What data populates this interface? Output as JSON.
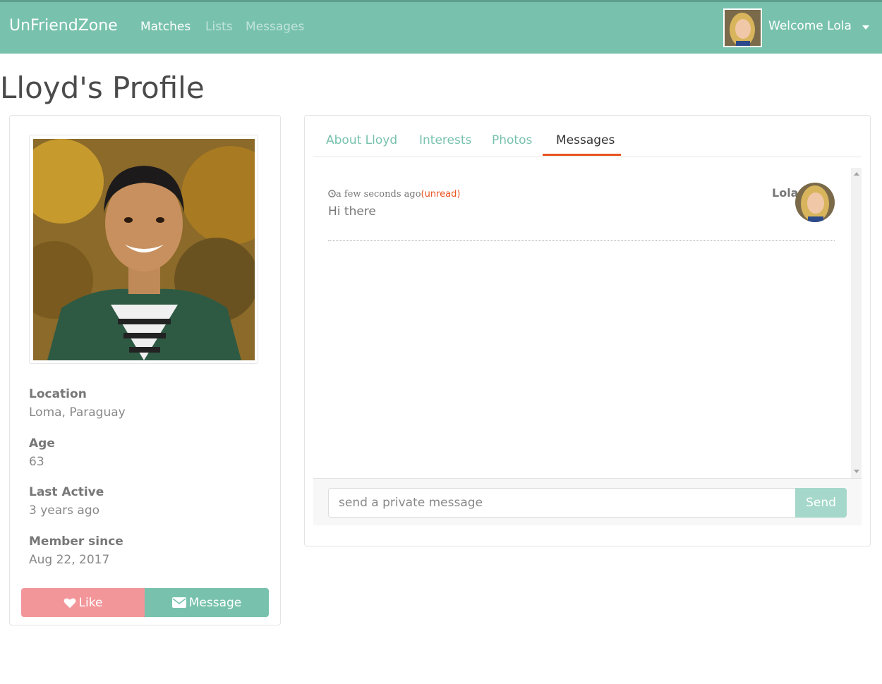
{
  "navbar": {
    "brand": "UnFriendZone",
    "links": [
      "Matches",
      "Lists",
      "Messages"
    ],
    "welcome": "Welcome Lola",
    "colors": {
      "background": "#78c2ad",
      "text": "#ffffff"
    }
  },
  "page": {
    "title": "Lloyd's Profile"
  },
  "profile": {
    "fields": [
      {
        "label": "Location",
        "value": "Loma, Paraguay"
      },
      {
        "label": "Age",
        "value": "63"
      },
      {
        "label": "Last Active",
        "value": "3 years ago"
      },
      {
        "label": "Member since",
        "value": "Aug 22, 2017"
      }
    ],
    "like_label": "Like",
    "message_label": "Message",
    "colors": {
      "like": "#f3969a",
      "message": "#78c2ad"
    }
  },
  "tabs": [
    "About Lloyd",
    "Interests",
    "Photos",
    "Messages"
  ],
  "active_tab": "Messages",
  "messages": [
    {
      "time": "a few seconds ago",
      "status": "(unread)",
      "text": "Hi there",
      "sender": "Lola"
    }
  ],
  "compose": {
    "placeholder": "send a private message",
    "send_label": "Send"
  },
  "colors": {
    "accent": "#e95420",
    "primary": "#78c2ad"
  }
}
